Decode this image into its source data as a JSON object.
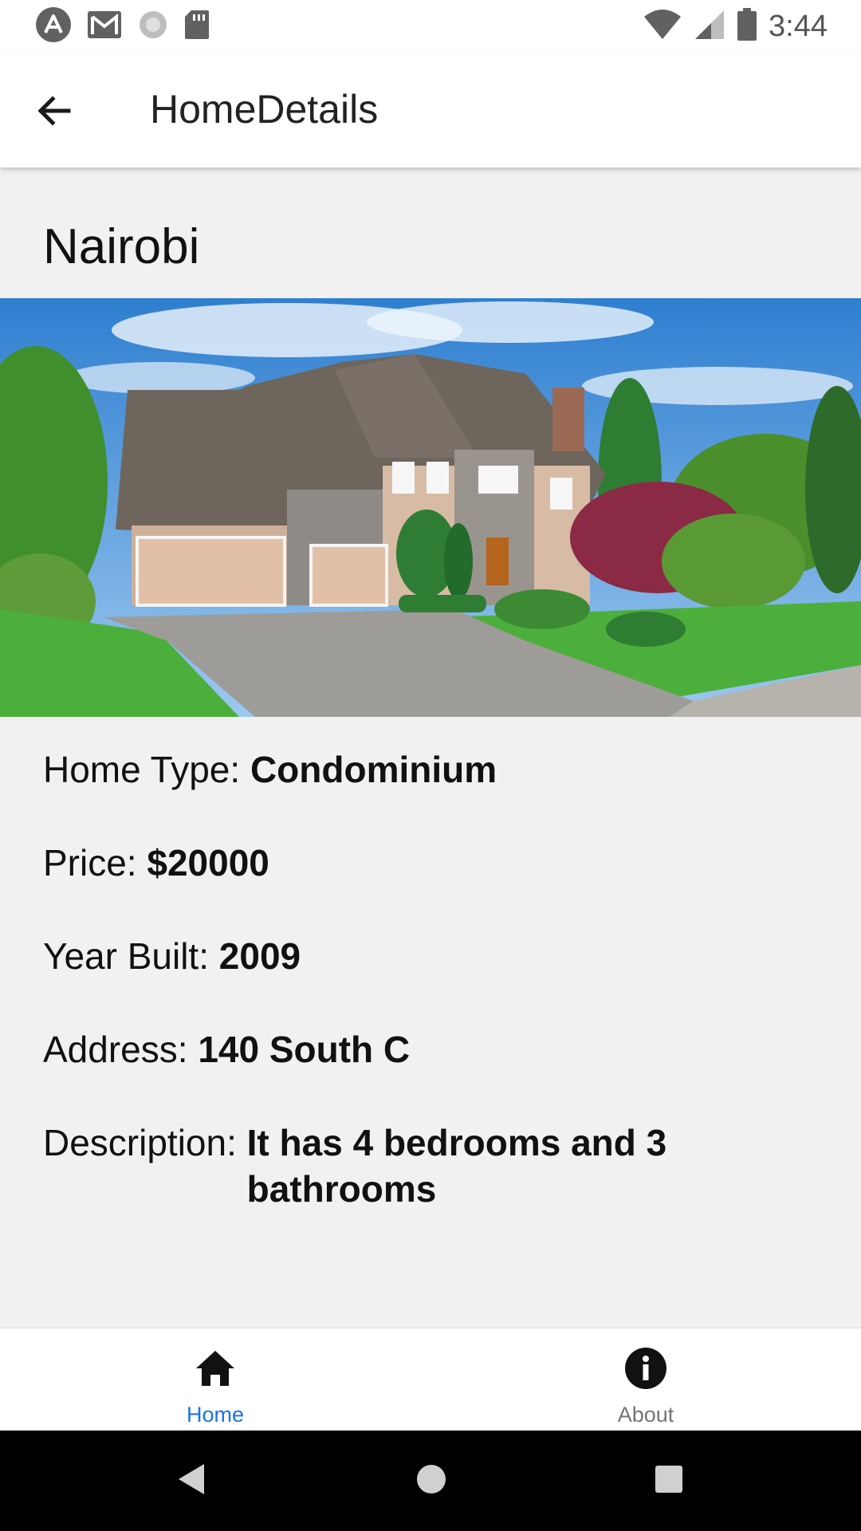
{
  "status_bar": {
    "time": "3:44",
    "left_icons": [
      "assistant-icon",
      "gmail-icon",
      "loading-icon",
      "sd-card-icon"
    ],
    "right_icons": [
      "wifi-icon",
      "signal-icon",
      "battery-icon"
    ]
  },
  "app_bar": {
    "title": "HomeDetails",
    "back_icon": "arrow-back-icon"
  },
  "home": {
    "city": "Nairobi",
    "photo_description": "",
    "details": [
      {
        "label": "Home Type: ",
        "value": "Condominium"
      },
      {
        "label": "Price: ",
        "value": "$20000"
      },
      {
        "label": "Year Built: ",
        "value": "2009"
      },
      {
        "label": "Address: ",
        "value": "140 South C"
      },
      {
        "label": "Description: ",
        "value": "It has 4 bedrooms and 3 bathrooms"
      }
    ]
  },
  "bottom_nav": {
    "items": [
      {
        "label": "Home",
        "icon": "home-icon",
        "active": true
      },
      {
        "label": "About",
        "icon": "info-icon",
        "active": false
      }
    ],
    "active_color": "#1a73e8",
    "inactive_color": "#757575"
  },
  "system_nav": {
    "buttons": [
      "back-triangle-icon",
      "home-circle-icon",
      "recents-square-icon"
    ]
  }
}
